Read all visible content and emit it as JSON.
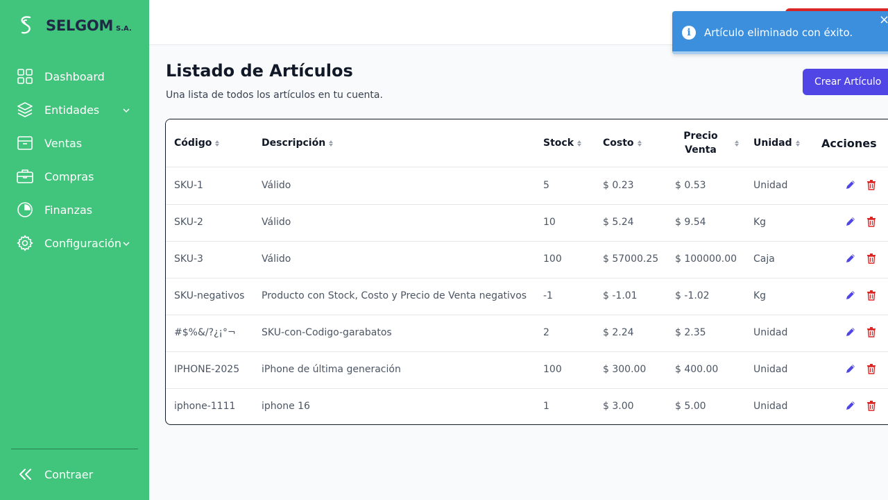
{
  "app": {
    "brand": "SELGOM",
    "brand_suffix": "S.A."
  },
  "sidebar": {
    "items": [
      {
        "label": "Dashboard",
        "icon": "grid-icon"
      },
      {
        "label": "Entidades",
        "icon": "layers-icon",
        "has_submenu": true
      },
      {
        "label": "Ventas",
        "icon": "archive-box-icon"
      },
      {
        "label": "Compras",
        "icon": "briefcase-icon"
      },
      {
        "label": "Finanzas",
        "icon": "pie-chart-icon"
      },
      {
        "label": "Configuración",
        "icon": "gear-icon",
        "has_submenu": true
      }
    ],
    "collapse_label": "Contraer"
  },
  "toast": {
    "message": "Artículo eliminado con éxito.",
    "close": "×",
    "info": "i"
  },
  "main": {
    "title": "Listado de Artículos",
    "subtitle": "Una lista de todos los artículos en tu cuenta.",
    "create_button": "Crear Artículo"
  },
  "table": {
    "headers": {
      "code": "Código",
      "description": "Descripción",
      "stock": "Stock",
      "cost": "Costo",
      "price_line1": "Precio",
      "price_line2": "Venta",
      "unit": "Unidad",
      "actions": "Acciones"
    },
    "rows": [
      {
        "code": "SKU-1",
        "description": "Válido",
        "stock": "5",
        "cost": "$ 0.23",
        "price": "$ 0.53",
        "unit": "Unidad"
      },
      {
        "code": "SKU-2",
        "description": "Válido",
        "stock": "10",
        "cost": "$ 5.24",
        "price": "$ 9.54",
        "unit": "Kg"
      },
      {
        "code": "SKU-3",
        "description": "Válido",
        "stock": "100",
        "cost": "$ 57000.25",
        "price": "$ 100000.00",
        "unit": "Caja"
      },
      {
        "code": "SKU-negativos",
        "description": "Producto con Stock, Costo y Precio de Venta negativos",
        "stock": "-1",
        "cost": "$ -1.01",
        "price": "$ -1.02",
        "unit": "Kg"
      },
      {
        "code": "#$%&/?¿¡°¬",
        "description": "SKU-con-Codigo-garabatos",
        "stock": "2",
        "cost": "$ 2.24",
        "price": "$ 2.35",
        "unit": "Unidad"
      },
      {
        "code": "IPHONE-2025",
        "description": "iPhone de última generación",
        "stock": "100",
        "cost": "$ 300.00",
        "price": "$ 400.00",
        "unit": "Unidad"
      },
      {
        "code": "iphone-1111",
        "description": "iphone 16",
        "stock": "1",
        "cost": "$ 3.00",
        "price": "$ 5.00",
        "unit": "Unidad"
      }
    ]
  },
  "colors": {
    "sidebar": "#41c47c",
    "primary": "#4f46e5",
    "danger": "#dc2626",
    "toast": "#3b8fdc"
  }
}
